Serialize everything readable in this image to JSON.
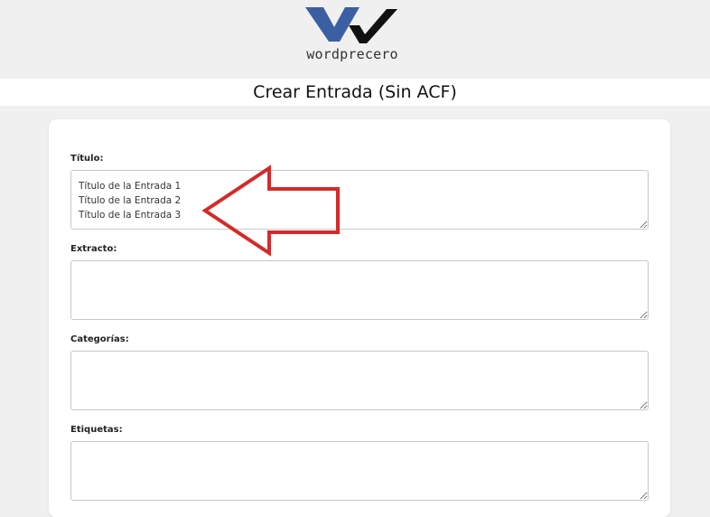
{
  "header": {
    "logo_text": "wordprecero",
    "logo_icon": "wordprecero-logo-icon",
    "logo_colors": {
      "blue": "#3b5fa3",
      "black": "#111111"
    }
  },
  "page": {
    "title": "Crear Entrada (Sin ACF)"
  },
  "form": {
    "fields": [
      {
        "label": "Título:",
        "value": "Título de la Entrada 1\nTítulo de la Entrada 2\nTítulo de la Entrada 3"
      },
      {
        "label": "Extracto:",
        "value": ""
      },
      {
        "label": "Categorías:",
        "value": ""
      },
      {
        "label": "Etiquetas:",
        "value": ""
      }
    ]
  },
  "annotation": {
    "icon": "red-arrow-left-icon",
    "color": "#d42a2a"
  }
}
